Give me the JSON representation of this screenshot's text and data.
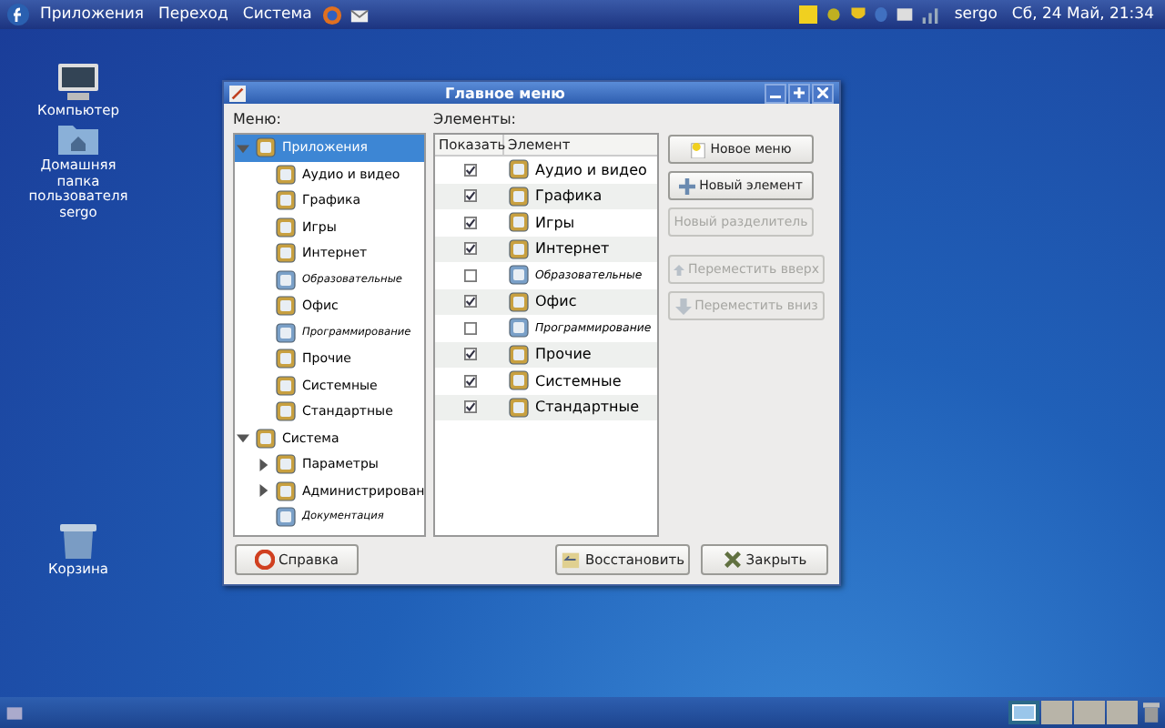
{
  "top_panel": {
    "menus": [
      "Приложения",
      "Переход",
      "Система"
    ],
    "user": "sergo",
    "clock": "Сб, 24 Май, 21:34"
  },
  "desktop_icons": [
    {
      "label": "Компьютер",
      "kind": "computer"
    },
    {
      "label": "Домашняя папка пользователя sergo",
      "kind": "folder"
    },
    {
      "label": "Корзина",
      "kind": "trash"
    }
  ],
  "window": {
    "title": "Главное меню",
    "menu_label": "Меню:",
    "items_label": "Элементы:",
    "tree": [
      {
        "label": "Приложения",
        "selected": true,
        "small": false,
        "expanded": true,
        "children": [
          {
            "label": "Аудио и видео",
            "selected": false,
            "small": false
          },
          {
            "label": "Графика",
            "selected": false,
            "small": false
          },
          {
            "label": "Игры",
            "selected": false,
            "small": false
          },
          {
            "label": "Интернет",
            "selected": false,
            "small": false
          },
          {
            "label": "Образовательные",
            "selected": false,
            "small": true
          },
          {
            "label": "Офис",
            "selected": false,
            "small": false
          },
          {
            "label": "Программирование",
            "selected": false,
            "small": true
          },
          {
            "label": "Прочие",
            "selected": false,
            "small": false
          },
          {
            "label": "Системные",
            "selected": false,
            "small": false
          },
          {
            "label": "Стандартные",
            "selected": false,
            "small": false
          }
        ]
      },
      {
        "label": "Система",
        "selected": false,
        "small": false,
        "expanded": true,
        "children": [
          {
            "label": "Параметры",
            "selected": false,
            "small": false,
            "expanded": false
          },
          {
            "label": "Администрирован",
            "selected": false,
            "small": false,
            "expanded": false
          },
          {
            "label": "Документация",
            "selected": false,
            "small": true
          }
        ]
      }
    ],
    "table": {
      "columns": [
        "Показать",
        "Элемент"
      ],
      "rows": [
        {
          "name": "Аудио и видео",
          "checked": true,
          "small": false
        },
        {
          "name": "Графика",
          "checked": true,
          "small": false
        },
        {
          "name": "Игры",
          "checked": true,
          "small": false
        },
        {
          "name": "Интернет",
          "checked": true,
          "small": false
        },
        {
          "name": "Образовательные",
          "checked": false,
          "small": true
        },
        {
          "name": "Офис",
          "checked": true,
          "small": false
        },
        {
          "name": "Программирование",
          "checked": false,
          "small": true
        },
        {
          "name": "Прочие",
          "checked": true,
          "small": false
        },
        {
          "name": "Системные",
          "checked": true,
          "small": false
        },
        {
          "name": "Стандартные",
          "checked": true,
          "small": false
        }
      ]
    },
    "side_buttons": [
      {
        "label": "Новое меню",
        "disabled": false,
        "kind": "new-menu"
      },
      {
        "label": "Новый элемент",
        "disabled": false,
        "kind": "new-item"
      },
      {
        "label": "Новый разделитель",
        "disabled": true,
        "kind": "plain"
      },
      {
        "label": "Переместить вверх",
        "disabled": true,
        "kind": "up"
      },
      {
        "label": "Переместить вниз",
        "disabled": true,
        "kind": "down"
      }
    ],
    "help_button": "Справка",
    "revert_button": "Восстановить",
    "close_button": "Закрыть"
  },
  "workspaces": [
    {
      "selected": true
    },
    {
      "selected": false
    },
    {
      "selected": false
    },
    {
      "selected": false
    }
  ]
}
